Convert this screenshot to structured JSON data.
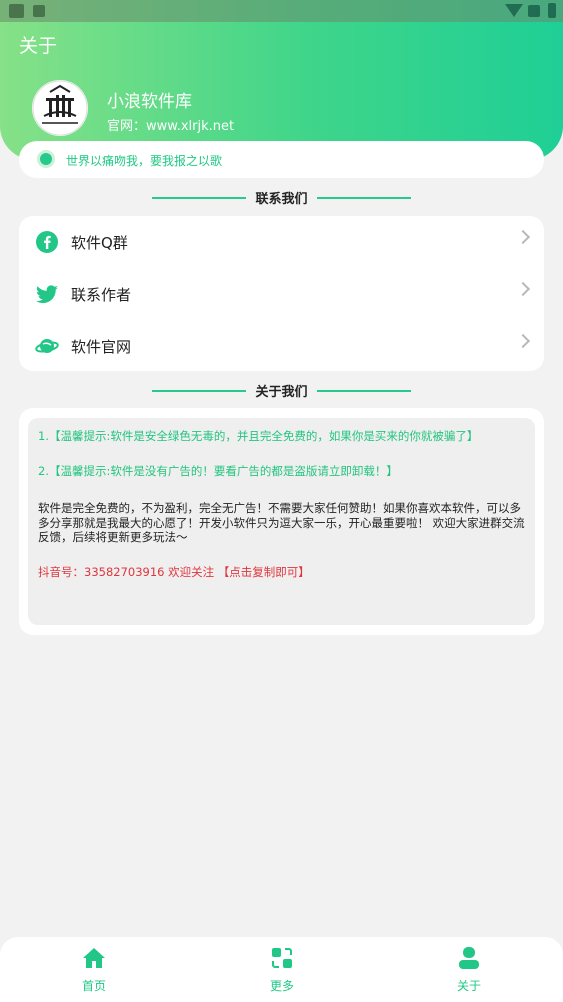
{
  "header": {
    "title": "关于",
    "app_name": "小浪软件库",
    "website": "官网：www.xlrjk.net"
  },
  "banner": {
    "text": "世界以痛吻我，要我报之以歌"
  },
  "sections": {
    "contact_title": "联系我们",
    "about_title": "关于我们"
  },
  "contact": {
    "items": [
      {
        "label": "软件Q群",
        "icon": "facebook-icon"
      },
      {
        "label": "联系作者",
        "icon": "twitter-icon"
      },
      {
        "label": "软件官网",
        "icon": "planet-icon"
      }
    ]
  },
  "about": {
    "tip1": "1.【温馨提示:软件是安全绿色无毒的，并且完全免费的，如果你是买来的你就被骗了】",
    "tip2": "2.【温馨提示:软件是没有广告的！要看广告的都是盗版请立即卸载！】",
    "desc": "软件是完全免费的，不为盈利，完全无广告！不需要大家任何赞助！如果你喜欢本软件，可以多多分享那就是我最大的心愿了！开发小软件只为逗大家一乐，开心最重要啦！ 欢迎大家进群交流反馈，后续将更新更多玩法～",
    "douyin": "抖音号：33582703916 欢迎关注 【点击复制即可】"
  },
  "tabbar": {
    "items": [
      {
        "label": "首页",
        "icon": "home-icon"
      },
      {
        "label": "更多",
        "icon": "swap-icon"
      },
      {
        "label": "关于",
        "icon": "user-icon"
      }
    ]
  },
  "colors": {
    "accent": "#22c787",
    "header_start": "#86e187",
    "header_end": "#1fcf96"
  }
}
